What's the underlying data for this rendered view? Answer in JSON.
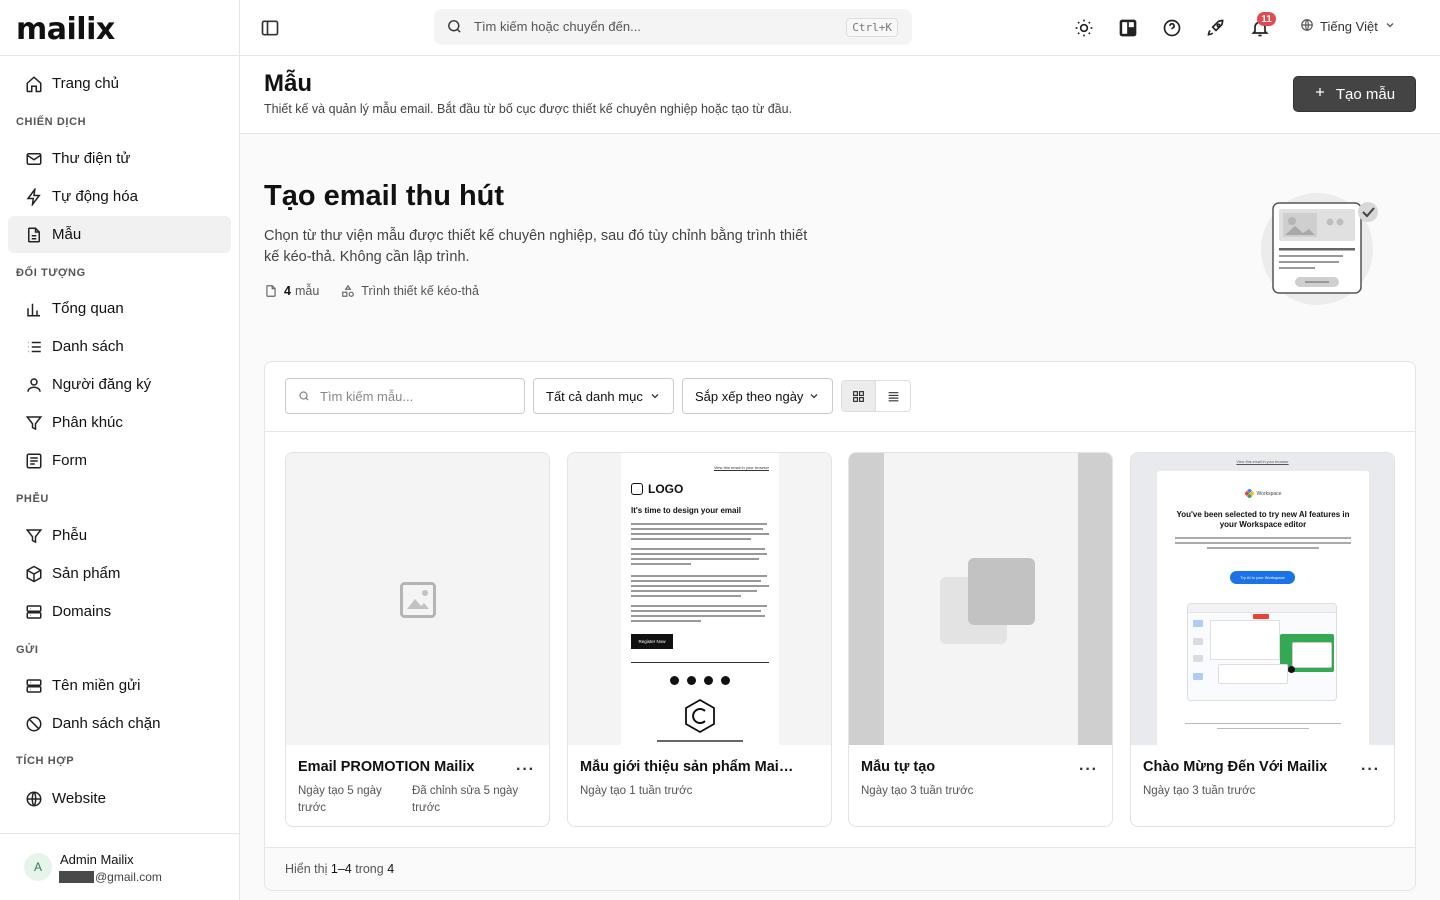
{
  "app": {
    "logo": "mailix"
  },
  "sidebar": {
    "home": "Trang chủ",
    "sections": {
      "campaigns": "CHIẾN DỊCH",
      "audience": "ĐỐI TƯỢNG",
      "funnels": "PHỄU",
      "sending": "GỬI",
      "integrations": "TÍCH HỢP"
    },
    "items": {
      "emails": "Thư điện tử",
      "automation": "Tự động hóa",
      "templates": "Mẫu",
      "overview": "Tổng quan",
      "lists": "Danh sách",
      "subscribers": "Người đăng ký",
      "segments": "Phân khúc",
      "forms": "Form",
      "funnels": "Phễu",
      "products": "Sản phẩm",
      "domains": "Domains",
      "sending_domains": "Tên miền gửi",
      "blocklist": "Danh sách chặn",
      "website": "Website"
    },
    "user": {
      "initial": "A",
      "name": "Admin Mailix",
      "email_suffix": "@gmail.com"
    }
  },
  "topbar": {
    "search_placeholder": "Tìm kiếm hoặc chuyển đến...",
    "shortcut": "Ctrl+K",
    "notification_count": "11",
    "language": "Tiếng Việt"
  },
  "page": {
    "title": "Mẫu",
    "subtitle": "Thiết kế và quản lý mẫu email. Bắt đầu từ bố cục được thiết kế chuyên nghiệp hoặc tạo từ đầu.",
    "create_button": "Tạo mẫu"
  },
  "hero": {
    "title": "Tạo email thu hút",
    "description": "Chọn từ thư viện mẫu được thiết kế chuyên nghiệp, sau đó tùy chỉnh bằng trình thiết kế kéo-thả. Không cần lập trình.",
    "template_count": "4",
    "template_count_label": "mẫu",
    "builder_label": "Trình thiết kế kéo-thả"
  },
  "filters": {
    "search_placeholder": "Tìm kiếm mẫu...",
    "category": "Tất cả danh mục",
    "sort": "Sắp xếp theo ngày"
  },
  "templates": [
    {
      "name": "Email PROMOTION Mailix",
      "created": "Ngày tạo 5 ngày trước",
      "edited": "Đã chỉnh sửa 5 ngày trước"
    },
    {
      "name": "Mẫu giới thiệu sản phẩm Mailix ...",
      "created": "Ngày tạo 1 tuần trước",
      "edited": ""
    },
    {
      "name": "Mẫu tự tạo",
      "created": "Ngày tạo 3 tuần trước",
      "edited": ""
    },
    {
      "name": "Chào Mừng Đến Với Mailix",
      "created": "Ngày tạo 3 tuần trước",
      "edited": ""
    }
  ],
  "thumb2": {
    "view_link": "View this email in your browser",
    "logo": "LOGO",
    "heading": "It's time to design your email",
    "cta": "Register Now"
  },
  "thumb4": {
    "view_link": "View this email in your browser",
    "brand": "Workspace",
    "heading": "You've been selected to try new AI features in your Workspace editor",
    "cta": "Try AI in your Workspace"
  },
  "pagination": {
    "prefix": "Hiển thị",
    "range": "1–4",
    "middle": "trong",
    "total": "4"
  }
}
